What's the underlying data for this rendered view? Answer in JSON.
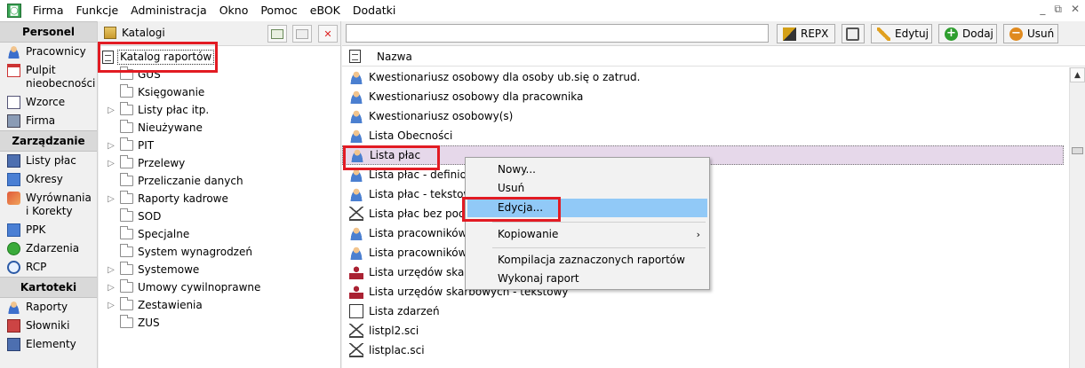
{
  "menubar": {
    "items": [
      "Firma",
      "Funkcje",
      "Administracja",
      "Okno",
      "Pomoc",
      "eBOK",
      "Dodatki"
    ],
    "window_controls": [
      "_",
      "⧉",
      "✕"
    ]
  },
  "nav": {
    "sections": [
      {
        "header": "Personel",
        "items": [
          "Pracownicy",
          "Pulpit nieobecności",
          "Wzorce",
          "Firma"
        ]
      },
      {
        "header": "Zarządzanie",
        "items": [
          "Listy płac",
          "Okresy",
          "Wyrównania i Korekty",
          "PPK",
          "Zdarzenia",
          "RCP"
        ]
      },
      {
        "header": "Kartoteki",
        "items": [
          "Raporty",
          "Słowniki",
          "Elementy"
        ]
      }
    ]
  },
  "catalog": {
    "title": "Katalogi",
    "delete_glyph": "✕",
    "root": "Katalog raportów",
    "expand_glyph": "▷",
    "nodes": [
      {
        "label": "GUS",
        "expandable": false
      },
      {
        "label": "Księgowanie",
        "expandable": false
      },
      {
        "label": "Listy płac itp.",
        "expandable": true
      },
      {
        "label": "Nieużywane",
        "expandable": false
      },
      {
        "label": "PIT",
        "expandable": true
      },
      {
        "label": "Przelewy",
        "expandable": true
      },
      {
        "label": "Przeliczanie danych",
        "expandable": false
      },
      {
        "label": "Raporty kadrowe",
        "expandable": true
      },
      {
        "label": "SOD",
        "expandable": false
      },
      {
        "label": "Specjalne",
        "expandable": false
      },
      {
        "label": "System wynagrodzeń",
        "expandable": false
      },
      {
        "label": "Systemowe",
        "expandable": true
      },
      {
        "label": "Umowy cywilnoprawne",
        "expandable": true
      },
      {
        "label": "Zestawienia",
        "expandable": true
      },
      {
        "label": "ZUS",
        "expandable": false
      }
    ]
  },
  "toolbar": {
    "search_value": "",
    "repx": "REPX",
    "edit": "Edytuj",
    "add": "Dodaj",
    "add_glyph": "+",
    "delete": "Usuń",
    "delete_glyph": "−"
  },
  "list": {
    "column_header": "Nazwa",
    "scroll_up": "▲",
    "rows": [
      {
        "label": "Kwestionariusz osobowy dla osoby ub.się o zatrud.",
        "icon": "person-icon"
      },
      {
        "label": "Kwestionariusz osobowy dla pracownika",
        "icon": "person-icon"
      },
      {
        "label": "Kwestionariusz osobowy(s)",
        "icon": "person-icon"
      },
      {
        "label": "Lista Obecności",
        "icon": "person-icon"
      },
      {
        "label": "Lista płac",
        "icon": "person-icon",
        "selected": true
      },
      {
        "label": "Lista płac - definiowa",
        "icon": "person-icon"
      },
      {
        "label": "Lista płac - tekstowy",
        "icon": "person-icon"
      },
      {
        "label": "Lista płac bez podpis",
        "icon": "triangle-icon"
      },
      {
        "label": "Lista pracowników",
        "icon": "person-icon"
      },
      {
        "label": "Lista pracowników - t",
        "icon": "person-icon"
      },
      {
        "label": "Lista urzędów skarbo",
        "icon": "stamp-icon"
      },
      {
        "label": "Lista urzędów skarbowych - tekstowy",
        "icon": "stamp-icon"
      },
      {
        "label": "Lista zdarzeń",
        "icon": "document-icon"
      },
      {
        "label": "listpl2.sci",
        "icon": "triangle-icon"
      },
      {
        "label": "listplac.sci",
        "icon": "triangle-icon"
      }
    ]
  },
  "context_menu": {
    "items": [
      "Nowy...",
      "Usuń",
      "Edycja...",
      "Kopiowanie",
      "Kompilacja zaznaczonych raportów",
      "Wykonaj raport"
    ],
    "highlighted": "Edycja...",
    "submenu_glyph": "›"
  },
  "colors": {
    "highlight_red": "#e21b23",
    "menu_hover": "#91c9f7",
    "selected_row": "#e6d8ea"
  }
}
